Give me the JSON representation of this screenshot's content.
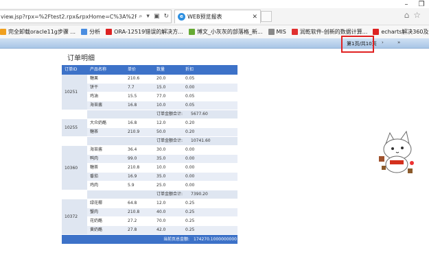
{
  "browser": {
    "address": "view.jsp?rpx=%2Ftest2.rpx&rpxHome=C%3A%2FUsers%2Fchao",
    "tab_title": "WEB预览报表",
    "favorites": [
      {
        "label": "完全卸载oracle11g步骤 ...",
        "color": "#f0a020"
      },
      {
        "label": "分析",
        "color": "#4a8de0"
      },
      {
        "label": "ORA-12519错误的解决方...",
        "color": "#d22"
      },
      {
        "label": "博文_小灰灰的部落格_新...",
        "color": "#6a3"
      },
      {
        "label": "MIS",
        "color": "#888"
      },
      {
        "label": "润乾软件-创新的数据计算...",
        "color": "#e03030"
      },
      {
        "label": "echarts解决360及IE8兼...",
        "color": "#d22"
      }
    ]
  },
  "toolbar": {
    "page_info": "第1页/共10页",
    "nav": "› »"
  },
  "report": {
    "title": "订单明细",
    "headers": [
      "订单ID",
      "产品名称",
      "单价",
      "数量",
      "折扣"
    ],
    "subtotal_label": "订单金额合计:",
    "grand_label": "当前页总金额:",
    "grand_value": "174270.1000000000",
    "orders": [
      {
        "id": "10251",
        "items": [
          [
            "糖果",
            "210.6",
            "20.0",
            "0.05"
          ],
          [
            "饼干",
            "7.7",
            "15.0",
            "0.00"
          ],
          [
            "鸡油",
            "15.5",
            "77.0",
            "0.05"
          ],
          [
            "海苔酱",
            "16.8",
            "10.0",
            "0.05"
          ]
        ],
        "subtotal": "5677.60"
      },
      {
        "id": "10255",
        "items": [
          [
            "大众奶酪",
            "16.8",
            "12.0",
            "0.20"
          ],
          [
            "糖茶",
            "210.9",
            "50.0",
            "0.20"
          ]
        ],
        "subtotal": "10741.60"
      },
      {
        "id": "10360",
        "items": [
          [
            "海苔酱",
            "36.4",
            "30.0",
            "0.00"
          ],
          [
            "鸭肉",
            "99.0",
            "35.0",
            "0.00"
          ],
          [
            "糖茶",
            "210.8",
            "10.0",
            "0.00"
          ],
          [
            "番茄",
            "16.9",
            "35.0",
            "0.00"
          ],
          [
            "鸡肉",
            "5.9",
            "25.0",
            "0.00"
          ]
        ],
        "subtotal": "7390.20"
      },
      {
        "id": "10372",
        "items": [
          [
            "绿花椰",
            "64.8",
            "12.0",
            "0.25"
          ],
          [
            "蟹肉",
            "210.8",
            "40.0",
            "0.25"
          ],
          [
            "花奶酪",
            "27.2",
            "70.0",
            "0.25"
          ],
          [
            "黄奶酪",
            "27.8",
            "42.0",
            "0.25"
          ]
        ],
        "subtotal": ""
      }
    ]
  }
}
